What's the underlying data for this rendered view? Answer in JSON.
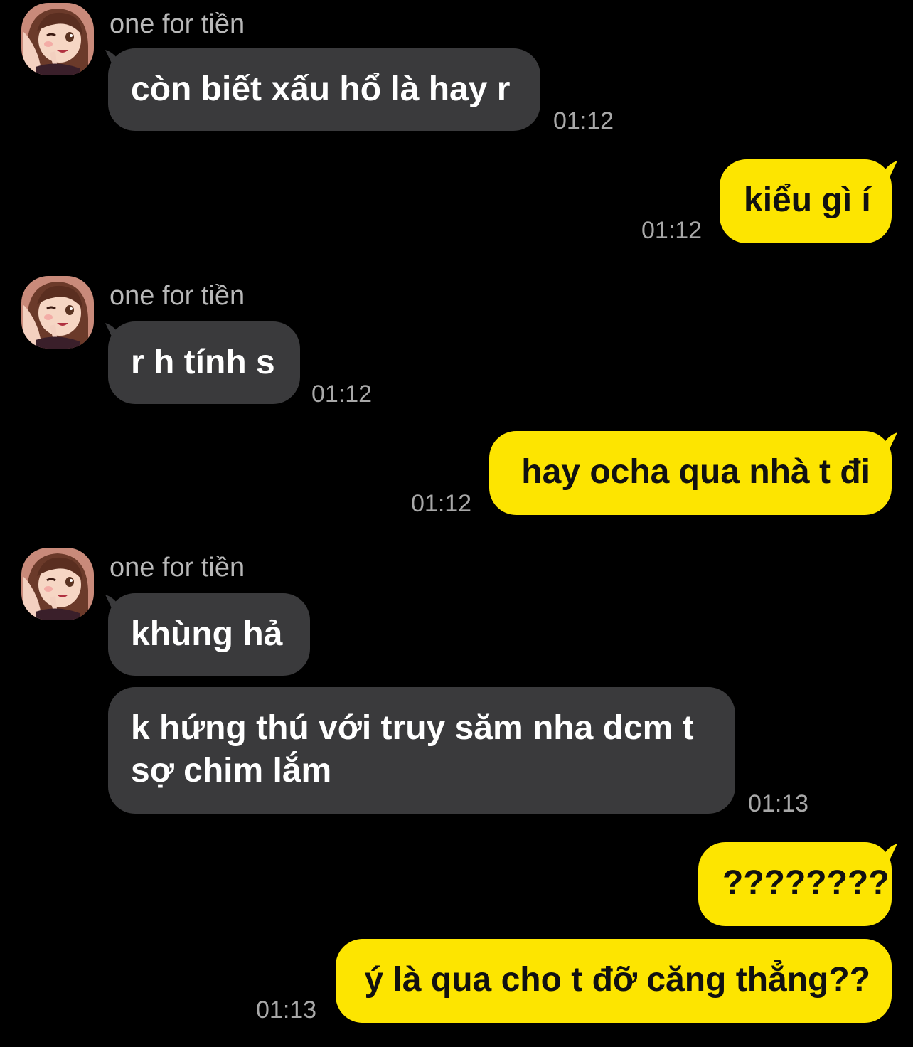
{
  "messages": [
    {
      "direction": "incoming",
      "sender": "one for tiền",
      "text": "còn biết xấu hổ là hay r",
      "time": "01:12"
    },
    {
      "direction": "outgoing",
      "text": "kiểu gì í",
      "time": "01:12"
    },
    {
      "direction": "incoming",
      "sender": "one for tiền",
      "text": "r h tính s",
      "time": "01:12"
    },
    {
      "direction": "outgoing",
      "text": "hay ocha qua nhà t đi",
      "time": "01:12"
    },
    {
      "direction": "incoming",
      "sender": "one for tiền",
      "text": "khùng hả"
    },
    {
      "direction": "incoming",
      "lines": [
        "k hứng thú với truy săm nha dcm t",
        "sợ chim lắm"
      ],
      "time": "01:13"
    },
    {
      "direction": "outgoing",
      "text": "????????"
    },
    {
      "direction": "outgoing",
      "text": "ý là qua cho t đỡ căng thẳng??",
      "time": "01:13"
    }
  ],
  "colors": {
    "background": "#000000",
    "incoming_bubble": "#3a3a3c",
    "outgoing_bubble": "#fde500",
    "timestamp": "#a8a8a8"
  },
  "icons": {
    "avatar": "avatar-icon"
  }
}
